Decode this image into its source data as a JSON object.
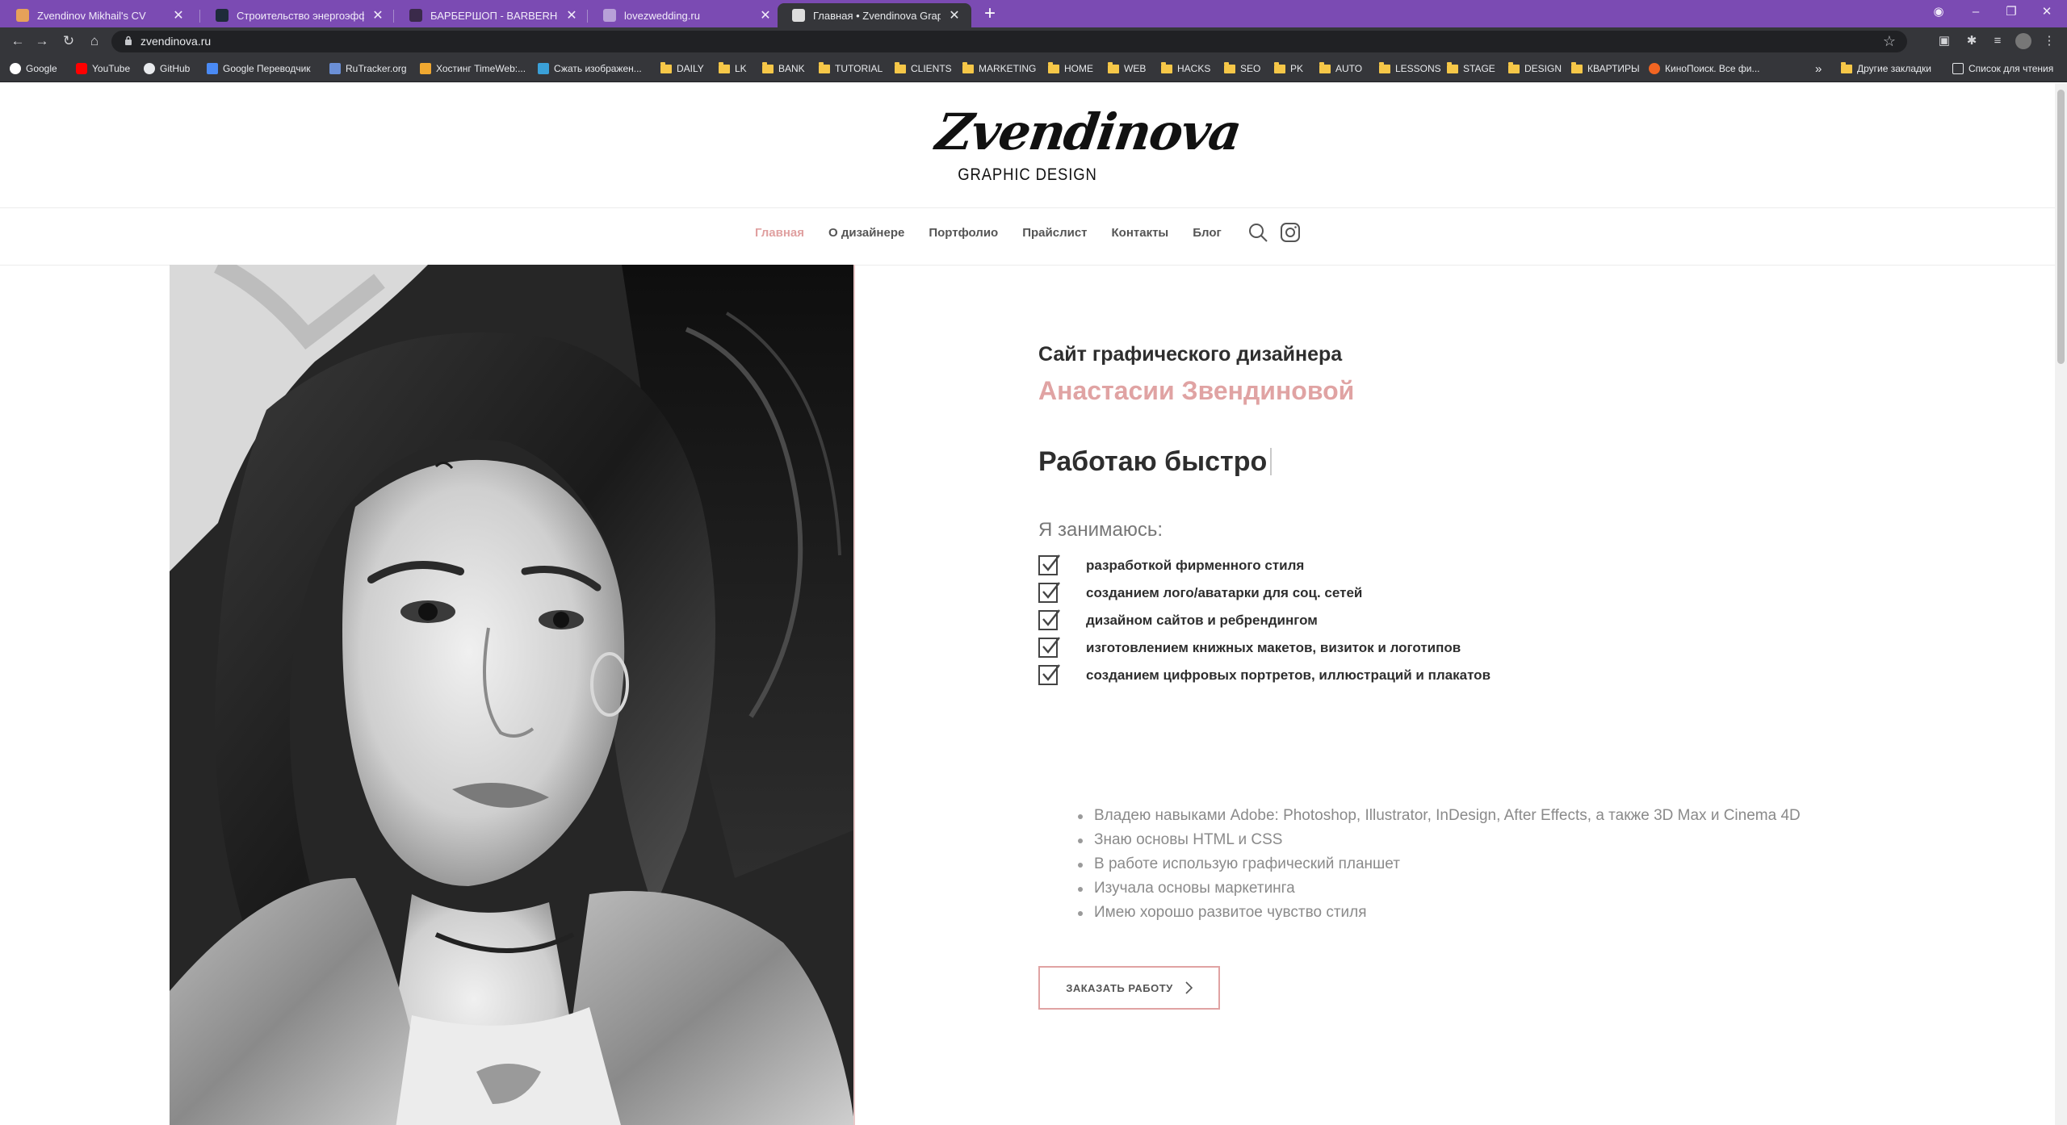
{
  "browser": {
    "tabs": [
      {
        "title": "Zvendinov Mikhail's CV"
      },
      {
        "title": "Строительство энергоэффекти"
      },
      {
        "title": "БАРБЕРШОП - BARBERHOUSE"
      },
      {
        "title": "lovezwedding.ru"
      },
      {
        "title": "Главная • Zvendinova Graphic D"
      }
    ],
    "url": "zvendinova.ru",
    "bookmarks": [
      "Google",
      "YouTube",
      "GitHub",
      "Google Переводчик",
      "RuTracker.org",
      "Хостинг TimeWeb:...",
      "Сжать изображен...",
      "DAILY",
      "LK",
      "BANK",
      "TUTORIAL",
      "CLIENTS",
      "MARKETING",
      "HOME",
      "WEB",
      "HACKS",
      "SEO",
      "PK",
      "AUTO",
      "LESSONS",
      "STAGE",
      "DESIGN",
      "КВАРТИРЫ",
      "КиноПоиск. Все фи..."
    ],
    "bookmarks_overflow": "»",
    "other_bookmarks": "Другие закладки",
    "reading_list": "Список для чтения"
  },
  "site": {
    "logo_script": "Zvendinova",
    "logo_sub": "GRAPHIC DESIGN",
    "menu": [
      "Главная",
      "О дизайнере",
      "Портфолио",
      "Прайслист",
      "Контакты",
      "Блог"
    ],
    "heading_site": "Сайт графического дизайнера",
    "heading_name": "Анастасии Звендиновой",
    "typed": "Работаю быстро",
    "doing_title": "Я занимаюсь:",
    "doing": [
      "разработкой фирменного стиля",
      "созданием лого/аватарки для соц. сетей",
      "дизайном сайтов и ребрендингом",
      "изготовлением книжных макетов, визиток и логотипов",
      "созданием цифровых портретов, иллюстраций и плакатов"
    ],
    "skills": [
      "Владею навыками Adobe: Photoshop, Illustrator, InDesign, After Effects, а также 3D Max и Cinema 4D",
      "Знаю основы HTML и CSS",
      "В работе использую графический планшет",
      "Изучала основы маркетинга",
      "Имею хорошо развитое чувство стиля"
    ],
    "cta": "ЗАКАЗАТЬ РАБОТУ"
  },
  "colors": {
    "accent": "#e0a3a3",
    "tabbar": "#7b4bb3",
    "chrome": "#35363a"
  }
}
